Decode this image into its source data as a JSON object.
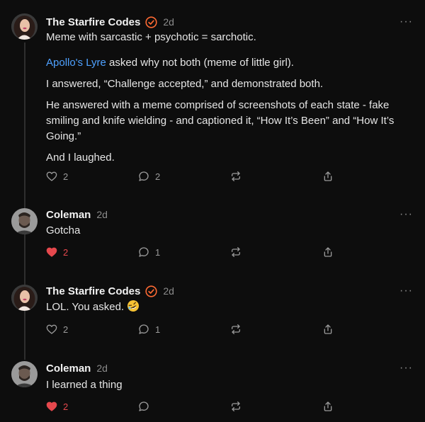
{
  "colors": {
    "background": "#0d0d0d",
    "text": "#e6e6e6",
    "muted": "#8c8c8c",
    "link": "#4ea1ff",
    "liked": "#e5484d",
    "verified": "#ff6a33"
  },
  "posts": [
    {
      "author": "The Starfire Codes",
      "verified": true,
      "time": "2d",
      "paragraphs": [
        "Meme with sarcastic + psychotic = sarchotic.",
        " asked why not both (meme of little girl).",
        "I answered, “Challenge accepted,” and demonstrated both.",
        "He answered with a meme comprised of screenshots of each state - fake smiling and knife wielding - and captioned it, “How It’s Been” and “How It’s Going.”",
        "And I laughed."
      ],
      "mention": "Apollo's Lyre",
      "likes": "2",
      "liked": false,
      "replies": "2"
    },
    {
      "author": "Coleman",
      "verified": false,
      "time": "2d",
      "text": "Gotcha",
      "likes": "2",
      "liked": true,
      "replies": "1"
    },
    {
      "author": "The Starfire Codes",
      "verified": true,
      "time": "2d",
      "text": "LOL. You asked.",
      "emoji": "rolling-on-floor-laughing-emoji",
      "likes": "2",
      "liked": false,
      "replies": "1"
    },
    {
      "author": "Coleman",
      "verified": false,
      "time": "2d",
      "text": "I learned a thing",
      "likes": "2",
      "liked": true,
      "replies": ""
    }
  ],
  "icons": {
    "like": "heart-icon",
    "reply": "speech-bubble-icon",
    "restack": "restack-arrows-icon",
    "share": "share-upload-icon",
    "more": "more-dots-icon",
    "verified": "verified-check-icon"
  },
  "more_glyph": "···"
}
